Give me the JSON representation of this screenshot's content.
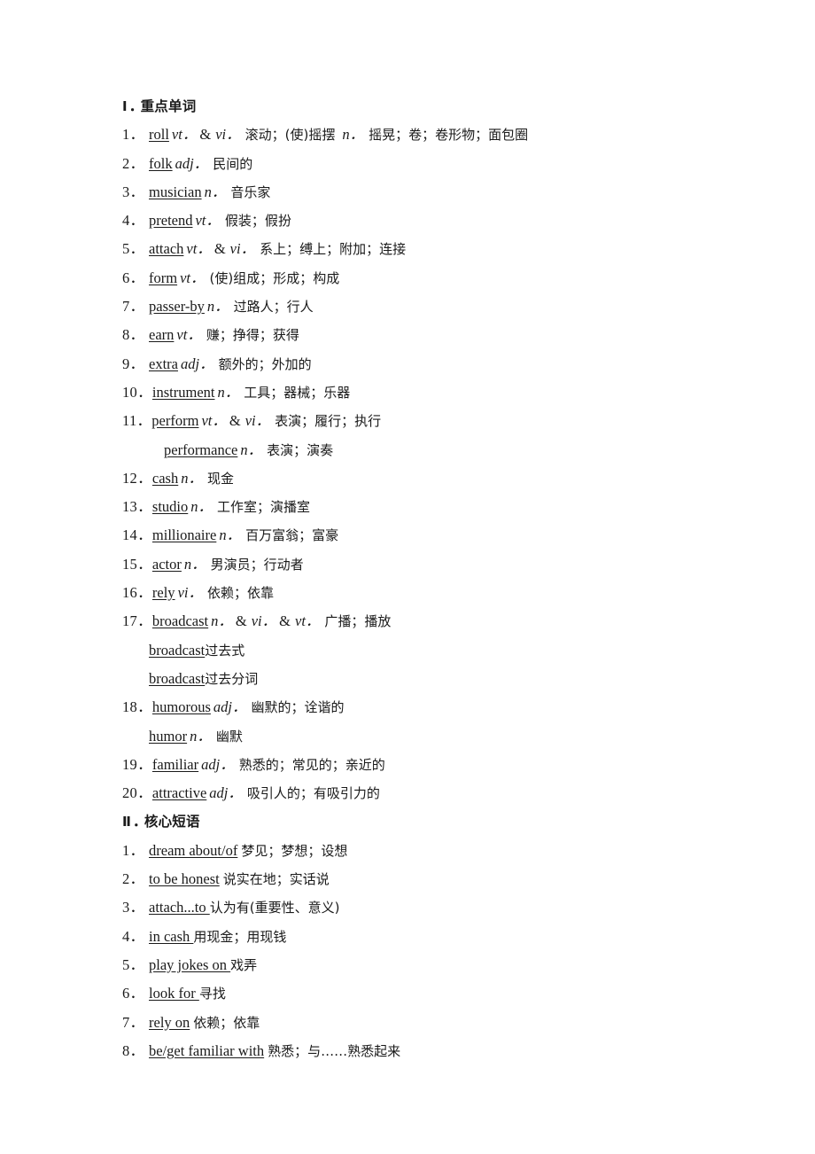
{
  "page": {
    "background": "#ffffff",
    "text_color": "#1a1a1a"
  },
  "sections": [
    {
      "roman": "Ⅰ",
      "dot": "．",
      "title": "重点单词"
    },
    {
      "roman": "Ⅱ",
      "dot": "．",
      "title": "核心短语"
    }
  ],
  "vocabulary": [
    {
      "num": "1．",
      "word": "roll",
      "pos1": "vt．",
      "amp": "&",
      "pos2": "vi．",
      "meaning": "滚动；(使)摇摆",
      "pos3": "n．",
      "meaning2": "摇晃；卷；卷形物；面包圈"
    },
    {
      "num": "2．",
      "word": "folk",
      "pos1": "adj．",
      "meaning": "民间的"
    },
    {
      "num": "3．",
      "word": "musician",
      "pos1": "n．",
      "meaning": "音乐家"
    },
    {
      "num": "4．",
      "word": "pretend",
      "pos1": "vt．",
      "meaning": "假装；假扮"
    },
    {
      "num": "5．",
      "word": "attach",
      "pos1": "vt．",
      "amp": "&",
      "pos2": "vi．",
      "meaning": "系上；缚上；附加；连接"
    },
    {
      "num": "6．",
      "word": "form",
      "pos1": "vt．",
      "meaning": "(使)组成；形成；构成"
    },
    {
      "num": "7．",
      "word": "passer-by",
      "pos1": "n．",
      "meaning": "过路人；行人"
    },
    {
      "num": "8．",
      "word": "earn",
      "pos1": "vt．",
      "meaning": "赚；挣得；获得"
    },
    {
      "num": "9．",
      "word": "extra",
      "pos1": "adj．",
      "meaning": "额外的；外加的"
    },
    {
      "num": "10．",
      "word": "instrument",
      "pos1": "n．",
      "meaning": "工具；器械；乐器"
    },
    {
      "num": "11．",
      "word": "perform",
      "pos1": "vt．",
      "amp": "&",
      "pos2": "vi．",
      "meaning": "表演；履行；执行",
      "sub": {
        "word": "performance",
        "pos1": "n．",
        "meaning": "表演；演奏",
        "indent": "deep"
      }
    },
    {
      "num": "12．",
      "word": "cash",
      "pos1": "n．",
      "meaning": "现金"
    },
    {
      "num": "13．",
      "word": "studio",
      "pos1": "n．",
      "meaning": "工作室；演播室"
    },
    {
      "num": "14．",
      "word": "millionaire",
      "pos1": "n．",
      "meaning": "百万富翁；富豪"
    },
    {
      "num": "15．",
      "word": "actor",
      "pos1": "n．",
      "meaning": "男演员；行动者"
    },
    {
      "num": "16．",
      "word": "rely",
      "pos1": "vi．",
      "meaning": "依赖；依靠"
    },
    {
      "num": "17．",
      "word": "broadcast",
      "pos1": "n．",
      "amp": "&",
      "pos2": "vi．",
      "amp2": "&",
      "pos3": "vt．",
      "meaning": "广播；播放",
      "subs": [
        {
          "word": "broadcast",
          "label": "过去式"
        },
        {
          "word": "broadcast",
          "label": "过去分词"
        }
      ]
    },
    {
      "num": "18．",
      "word": "humorous",
      "pos1": "adj．",
      "meaning": "幽默的；诠谐的",
      "sub": {
        "word": "humor",
        "pos1": "n．",
        "meaning": "幽默",
        "indent": "normal"
      }
    },
    {
      "num": "19．",
      "word": "familiar",
      "pos1": "adj．",
      "meaning": "熟悉的；常见的；亲近的"
    },
    {
      "num": "20．",
      "word": "attractive",
      "pos1": "adj．",
      "meaning": "吸引人的；有吸引力的"
    }
  ],
  "phrases": [
    {
      "num": "1．",
      "phrase": "dream about/of",
      "meaning": "梦见；梦想；设想",
      "trailing_space": false
    },
    {
      "num": "2．",
      "phrase": "to be honest",
      "meaning": "说实在地；实话说",
      "trailing_space": false
    },
    {
      "num": "3．",
      "phrase": "attach...to ",
      "meaning": "认为有(重要性、意义)",
      "trailing_space": true
    },
    {
      "num": "4．",
      "phrase": "in cash ",
      "meaning": "用现金；用现钱",
      "trailing_space": true
    },
    {
      "num": "5．",
      "phrase": "play jokes on ",
      "meaning": "戏弄",
      "trailing_space": true
    },
    {
      "num": "6．",
      "phrase": "look for ",
      "meaning": "寻找",
      "trailing_space": true
    },
    {
      "num": "7．",
      "phrase": "rely on",
      "meaning": "依赖；依靠",
      "trailing_space": false
    },
    {
      "num": "8．",
      "phrase": "be/get familiar with",
      "meaning": "熟悉；与……熟悉起来",
      "trailing_space": false
    }
  ]
}
